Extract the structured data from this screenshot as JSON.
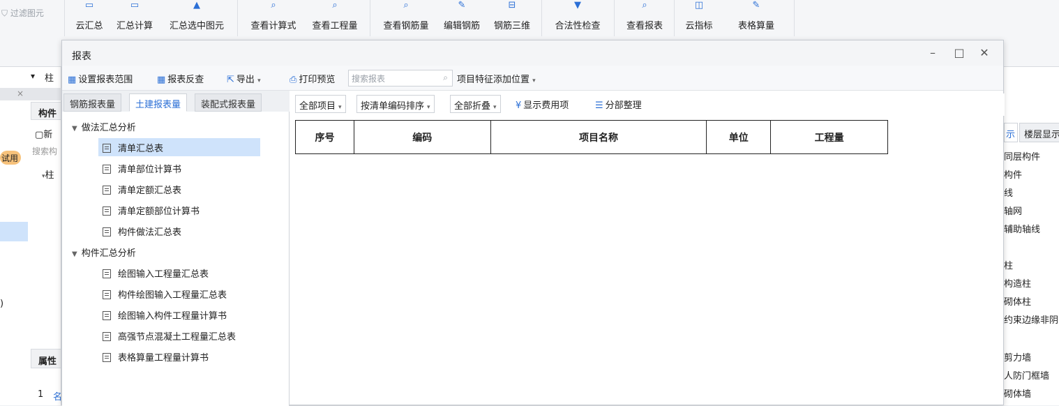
{
  "ribbon": {
    "filter_label": "过滤图元",
    "buttons": [
      {
        "name": "cloud-summary",
        "label": "云汇总"
      },
      {
        "name": "summary-calc",
        "label": "汇总计算"
      },
      {
        "name": "summary-selected",
        "label": "汇总选中图元"
      },
      {
        "name": "view-formula",
        "label": "查看计算式"
      },
      {
        "name": "view-quantity",
        "label": "查看工程量"
      },
      {
        "name": "view-rebar-quantity",
        "label": "查看钢筋量"
      },
      {
        "name": "edit-rebar",
        "label": "编辑钢筋"
      },
      {
        "name": "rebar-3d",
        "label": "钢筋三维"
      },
      {
        "name": "legality-check",
        "label": "合法性检查"
      },
      {
        "name": "view-report",
        "label": "查看报表"
      },
      {
        "name": "cloud-index",
        "label": "云指标"
      },
      {
        "name": "table-quantity",
        "label": "表格算量"
      }
    ]
  },
  "left_panel": {
    "dropdown_value": "柱",
    "header": "构件",
    "new_label": "新",
    "search_placeholder": "搜索构",
    "badge": "试用",
    "tree_item": "柱",
    "property_header": "属性",
    "row_num": "1",
    "row_text": "名",
    "paren": ")"
  },
  "right_panel": {
    "tab1": "示",
    "tab2": "楼层显示",
    "items": [
      "同层构件",
      "构件",
      "线",
      "轴网",
      "辅助轴线",
      "柱",
      "构造柱",
      "砌体柱",
      "约束边缘非阴",
      "剪力墙",
      "人防门框墙",
      "砌体墙"
    ],
    "blank": ""
  },
  "dialog": {
    "title": "报表",
    "toolbar": {
      "set_range": "设置报表范围",
      "reverse_check": "报表反查",
      "export": "导出",
      "print_preview": "打印预览",
      "search_placeholder": "搜索报表",
      "feature_position": "项目特征添加位置"
    },
    "tabs": [
      "钢筋报表量",
      "土建报表量",
      "装配式报表量"
    ],
    "tree": {
      "group1": "做法汇总分析",
      "group1_items": [
        "清单汇总表",
        "清单部位计算书",
        "清单定额汇总表",
        "清单定额部位计算书",
        "构件做法汇总表"
      ],
      "group2": "构件汇总分析",
      "group2_items": [
        "绘图输入工程量汇总表",
        "构件绘图输入工程量汇总表",
        "绘图输入构件工程量计算书",
        "高强节点混凝土工程量汇总表",
        "表格算量工程量计算书"
      ]
    },
    "report_toolbar": {
      "all_items": "全部项目",
      "sort": "按清单编码排序",
      "fold": "全部折叠",
      "show_fee": "显示费用项",
      "organize": "分部整理"
    },
    "table_headers": [
      "序号",
      "编码",
      "项目名称",
      "单位",
      "工程量"
    ]
  }
}
